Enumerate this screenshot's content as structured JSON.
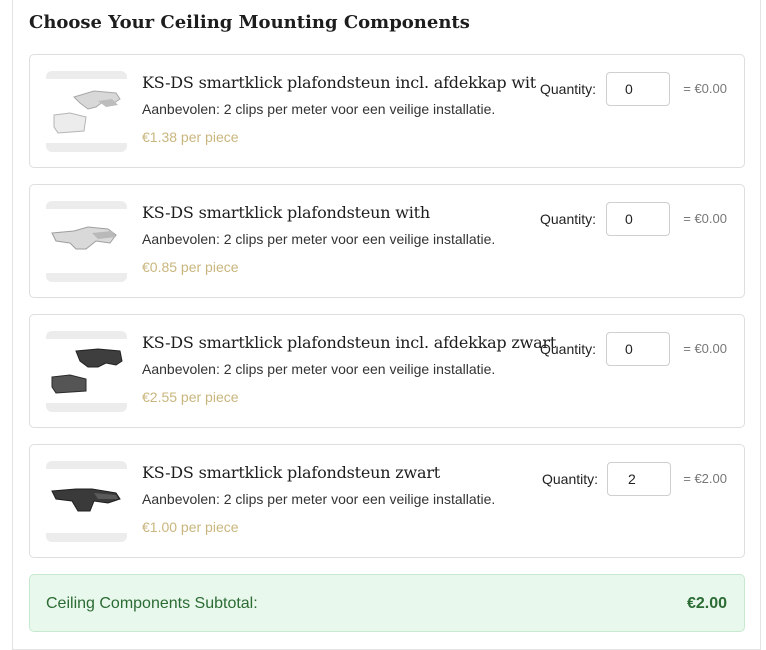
{
  "section": {
    "title": "Choose Your Ceiling Mounting Components"
  },
  "products": [
    {
      "name": "KS-DS smartklick plafondsteun incl. afdekkap wit",
      "description": "Aanbevolen: 2 clips per meter voor een veilige installatie.",
      "price": "€1.38 per piece",
      "quantity_label": "Quantity:",
      "quantity": "0",
      "line_total": "= €0.00"
    },
    {
      "name": "KS-DS smartklick plafondsteun with",
      "description": "Aanbevolen: 2 clips per meter voor een veilige installatie.",
      "price": "€0.85 per piece",
      "quantity_label": "Quantity:",
      "quantity": "0",
      "line_total": "= €0.00"
    },
    {
      "name": "KS-DS smartklick plafondsteun incl. afdekkap zwart",
      "description": "Aanbevolen: 2 clips per meter voor een veilige installatie.",
      "price": "€2.55 per piece",
      "quantity_label": "Quantity:",
      "quantity": "0",
      "line_total": "= €0.00"
    },
    {
      "name": "KS-DS smartklick plafondsteun zwart",
      "description": "Aanbevolen: 2 clips per meter voor een veilige installatie.",
      "price": "€1.00 per piece",
      "quantity_label": "Quantity:",
      "quantity": "2",
      "line_total": "= €2.00"
    }
  ],
  "subtotal": {
    "label": "Ceiling Components Subtotal:",
    "value": "€2.00"
  },
  "colors": {
    "price": "#c9b67e",
    "subtotal_bg": "#e9f8ec",
    "subtotal_text": "#2b6b34"
  }
}
